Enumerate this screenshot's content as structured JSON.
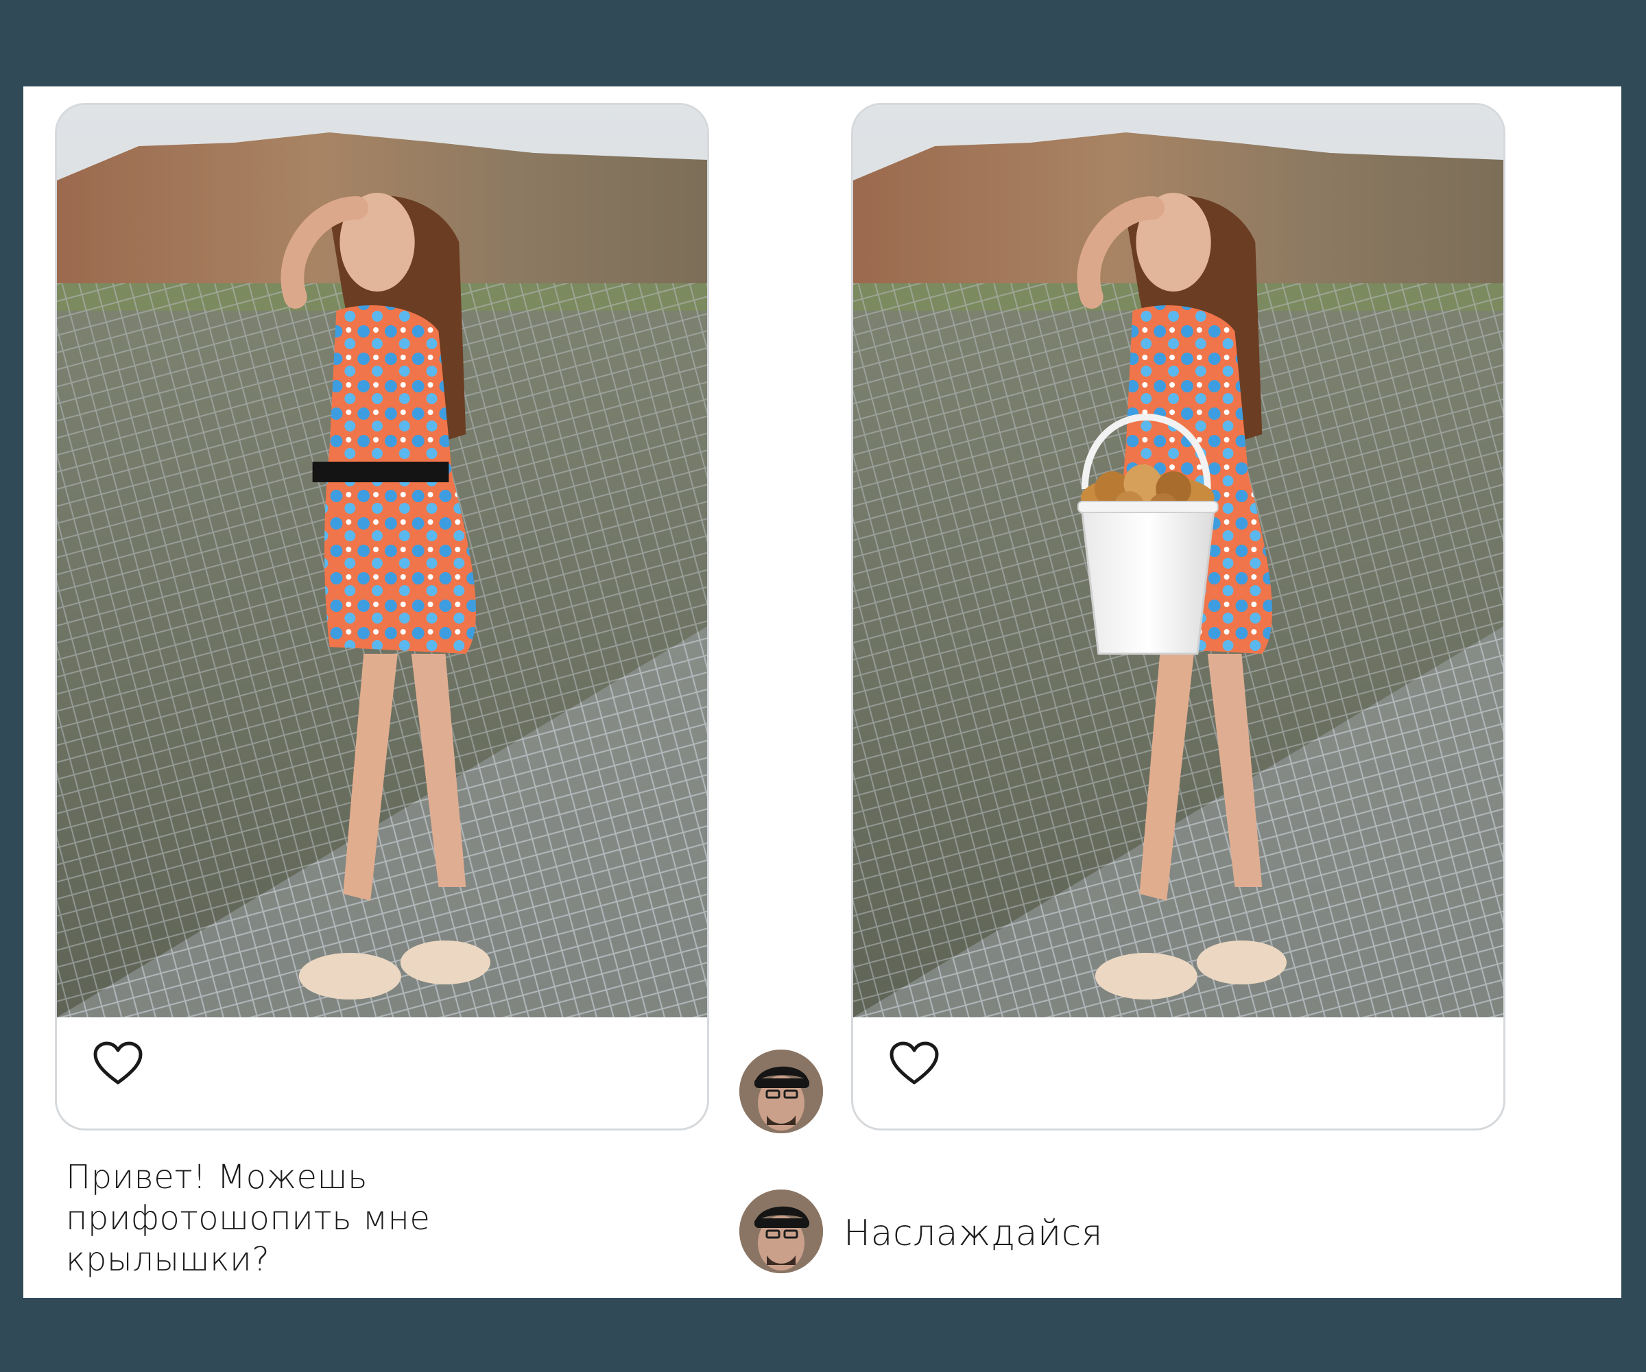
{
  "chat": {
    "request_text": "Привет! Можешь прифотошопить мне крылышки?",
    "reply_text": "Наслаждайся"
  },
  "posts": [
    {
      "photo_name": "girl-on-net-bridge-photo",
      "like_icon": "heart-outline-icon"
    },
    {
      "photo_name": "girl-with-chicken-wings-bucket-photo",
      "like_icon": "heart-outline-icon"
    }
  ],
  "colors": {
    "background": "#314a57",
    "panel": "#ffffff",
    "card_border": "#d6d9dc",
    "text": "#1d1d1d"
  }
}
